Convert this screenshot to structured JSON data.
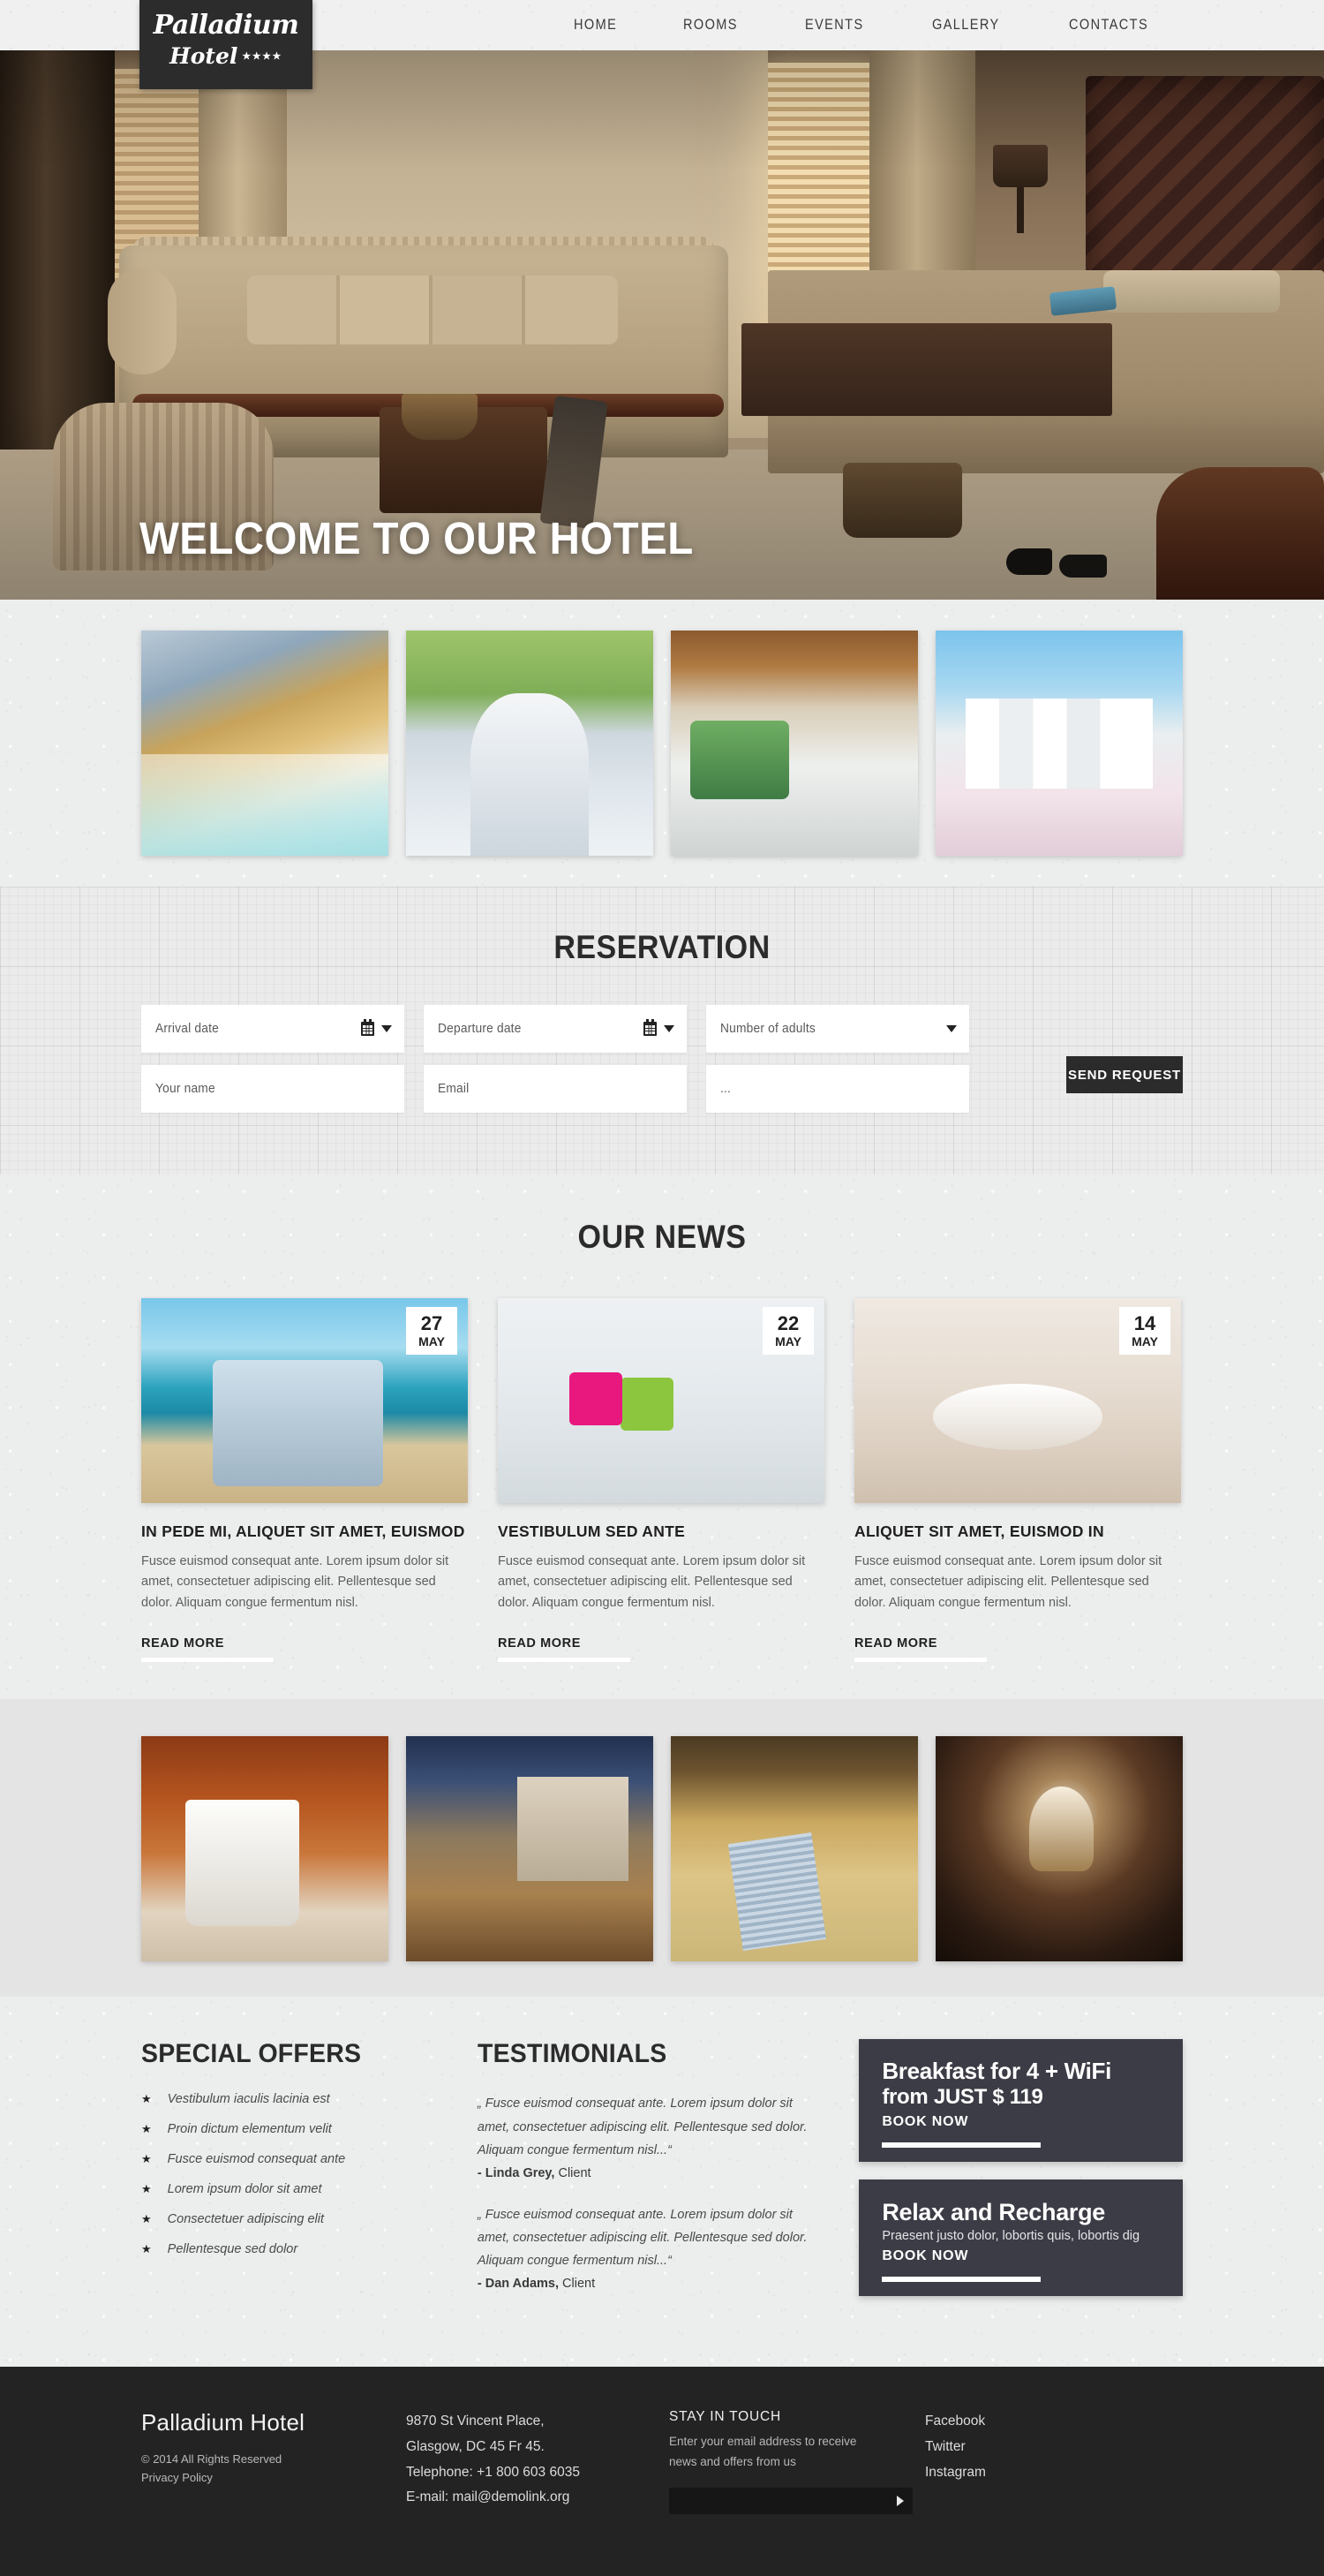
{
  "header": {
    "logo": {
      "main": "Palladium",
      "sub": "Hotel",
      "stars": "★★★★"
    },
    "nav": [
      {
        "label": "HOME"
      },
      {
        "label": "ROOMS"
      },
      {
        "label": "EVENTS"
      },
      {
        "label": "GALLERY"
      },
      {
        "label": "CONTACTS"
      }
    ]
  },
  "hero": {
    "title": "WELCOME TO OUR HOTEL"
  },
  "gallery_top": [
    {
      "name": "lobby-bar"
    },
    {
      "name": "couple-with-map"
    },
    {
      "name": "balcony-bed"
    },
    {
      "name": "wedding-chairs"
    }
  ],
  "reservation": {
    "title": "RESERVATION",
    "fields": {
      "arrival": {
        "placeholder": "Arrival date",
        "value": ""
      },
      "departure": {
        "placeholder": "Departure date",
        "value": ""
      },
      "adults": {
        "placeholder": "Number of adults",
        "value": ""
      },
      "name": {
        "placeholder": "Your name",
        "value": ""
      },
      "email": {
        "placeholder": "Email",
        "value": ""
      },
      "extra": {
        "placeholder": "...",
        "value": ""
      }
    },
    "submit_label": "SEND REQUEST"
  },
  "news": {
    "title": "OUR NEWS",
    "read_more_label": "READ MORE",
    "items": [
      {
        "day": "27",
        "month": "MAY",
        "title": "IN PEDE MI, ALIQUET SIT AMET, EUISMOD",
        "body": "Fusce euismod consequat ante. Lorem ipsum dolor sit amet, consectetuer adipiscing elit. Pellentesque sed dolor. Aliquam congue fermentum nisl."
      },
      {
        "day": "22",
        "month": "MAY",
        "title": "VESTIBULUM SED ANTE",
        "body": "Fusce euismod consequat ante. Lorem ipsum dolor sit amet, consectetuer adipiscing elit. Pellentesque sed dolor. Aliquam congue fermentum nisl."
      },
      {
        "day": "14",
        "month": "MAY",
        "title": "ALIQUET SIT AMET, EUISMOD IN",
        "body": "Fusce euismod consequat ante. Lorem ipsum dolor sit amet, consectetuer adipiscing elit. Pellentesque sed dolor. Aliquam congue fermentum nisl."
      }
    ]
  },
  "gallery_bottom": [
    {
      "name": "coffee-mug"
    },
    {
      "name": "lounge-interior"
    },
    {
      "name": "sofa-pillow"
    },
    {
      "name": "service-bell"
    }
  ],
  "special_offers": {
    "title": "SPECIAL OFFERS",
    "items": [
      {
        "label": "Vestibulum iaculis lacinia est"
      },
      {
        "label": "Proin dictum elementum velit"
      },
      {
        "label": "Fusce euismod consequat ante"
      },
      {
        "label": "Lorem ipsum dolor sit amet"
      },
      {
        "label": "Consectetuer adipiscing elit"
      },
      {
        "label": "Pellentesque sed dolor"
      }
    ]
  },
  "testimonials": {
    "title": "TESTIMONIALS",
    "items": [
      {
        "quote": "„ Fusce euismod consequat ante. Lorem ipsum dolor sit amet, consectetuer adipiscing elit. Pellentesque sed dolor. Aliquam congue fermentum nisl...“",
        "author": "- Linda Grey,",
        "role": " Client"
      },
      {
        "quote": "„ Fusce euismod consequat ante. Lorem ipsum dolor sit amet, consectetuer adipiscing elit. Pellentesque sed dolor. Aliquam congue fermentum nisl...“",
        "author": "- Dan Adams,",
        "role": " Client"
      }
    ]
  },
  "promos": [
    {
      "line1": "Breakfast for 4 + WiFi",
      "line2": "from JUST $ 119",
      "sub": "",
      "cta": "BOOK NOW"
    },
    {
      "line1": "Relax and Recharge",
      "line2": "",
      "sub": "Praesent justo dolor, lobortis quis, lobortis dig",
      "cta": "BOOK NOW"
    }
  ],
  "footer": {
    "brand": "Palladium Hotel",
    "copyright": "© 2014 All Rights Reserved",
    "privacy": "Privacy Policy",
    "address_line1": "9870 St Vincent Place,",
    "address_line2": "Glasgow, DC 45 Fr 45.",
    "telephone": "Telephone:  +1 800 603 6035",
    "email": "E-mail: mail@demolink.org",
    "stay_title": "STAY IN TOUCH",
    "stay_text": "Enter your email address to receive news and offers from us",
    "subscribe_placeholder": "",
    "subscribe_value": "",
    "social": [
      {
        "label": "Facebook"
      },
      {
        "label": "Twitter"
      },
      {
        "label": "Instagram"
      }
    ]
  },
  "colors": {
    "dark": "#232323",
    "promo": "#3c3c46",
    "logo_bg": "#2c2c2c",
    "paper": "#eceded"
  }
}
